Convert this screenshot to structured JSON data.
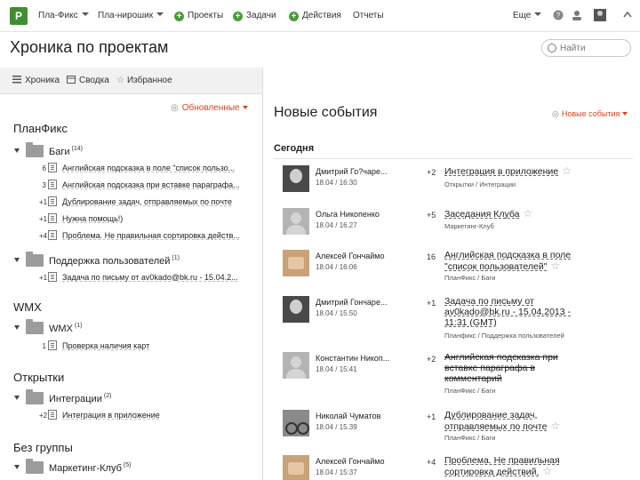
{
  "topnav": {
    "logo": "P",
    "planfix": "Пла-Фикс",
    "planning": "Пла-нирошик",
    "projects": "Проекты",
    "tasks": "Задачи",
    "actions": "Действия",
    "reports": "Отчеты",
    "more": "Еще"
  },
  "header": {
    "title": "Хроника по проектам",
    "search_placeholder": "Найти"
  },
  "left_tabs": [
    "Хроника",
    "Сводка",
    "Избранное"
  ],
  "left_filter": "Обновленные",
  "groups": [
    {
      "title": "ПланФикс",
      "folders": [
        {
          "name": "Баги",
          "count": "(14)",
          "tasks": [
            {
              "num": "6",
              "title": "Английская подсказка в поле \"список пользо..."
            },
            {
              "num": "3",
              "title": "Английская подсказка при вставке параграфа..."
            },
            {
              "num": "+1",
              "title": "Дублирование задач, отправляемых по почте"
            },
            {
              "num": "+1",
              "title": "Нужна помощь!)"
            },
            {
              "num": "+4",
              "title": "Проблема. Не правильная сортировка действ..."
            }
          ]
        },
        {
          "name": "Поддержка пользователей",
          "count": "(1)",
          "tasks": [
            {
              "num": "+1",
              "title": "Задача по письму от av0kado@bk.ru - 15.04.2..."
            }
          ]
        }
      ]
    },
    {
      "title": "WMX",
      "folders": [
        {
          "name": "WMX",
          "count": "(1)",
          "tasks": [
            {
              "num": "1",
              "title": "Проверка наличия карт"
            }
          ]
        }
      ]
    },
    {
      "title": "Открытки",
      "folders": [
        {
          "name": "Интеграции",
          "count": "(2)",
          "tasks": [
            {
              "num": "+2",
              "title": "Интеграция в приложение"
            }
          ]
        }
      ]
    },
    {
      "title": "Без группы",
      "folders": [
        {
          "name": "Маркетинг-Клуб",
          "count": "(5)",
          "tasks": []
        }
      ]
    }
  ],
  "main": {
    "title": "Новые события",
    "filter": "Новые события",
    "section": "Сегодня",
    "events": [
      {
        "author": "Дмитрий Го?чаре...",
        "time": "18.04 / 16:30",
        "count": "+2",
        "title": "Интеграция в приложение",
        "sub": "Открытки / Интеграции",
        "avatar": "dark"
      },
      {
        "author": "Ольга Никопенко",
        "time": "18.04 / 16.27",
        "count": "+5",
        "title": "Заседания Клуба",
        "sub": "Маркетинг-Клуб",
        "avatar": "gray"
      },
      {
        "author": "Алексей Гончаймо",
        "time": "18.04 / 16:06",
        "count": "16",
        "title": "Английская подсказка в поле \"список пользователей\"",
        "sub": "ПланФикс / Баги",
        "avatar": "warm"
      },
      {
        "author": "Дмитрий Гончаре...",
        "time": "18.04 / 15.50",
        "count": "+1",
        "title": "Задача по письму от av0kado@bk.ru - 15.04.2013 - 11:31 (GMT)",
        "sub": "Планфикс / Поддержка пользователей",
        "avatar": "dark"
      },
      {
        "author": "Константин Никоп...",
        "time": "18.04 / 15:41",
        "count": "+2",
        "title": "Английская подсказка при вставке параграфа в комментарий",
        "sub": "ПланФикс / Баги",
        "avatar": "gray"
      },
      {
        "author": "Николай Чуматов",
        "time": "18.04 / 15.39",
        "count": "+1",
        "title": "Дублирование задач, отправляемых по почте",
        "sub": "ПланФикс / Баги",
        "avatar": "bike"
      },
      {
        "author": "Алексей Гончаймо",
        "time": "18.04 / 15:37",
        "count": "+4",
        "title": "Проблема. Не правильная сортировка действий.",
        "sub": "",
        "avatar": "warm"
      }
    ]
  }
}
